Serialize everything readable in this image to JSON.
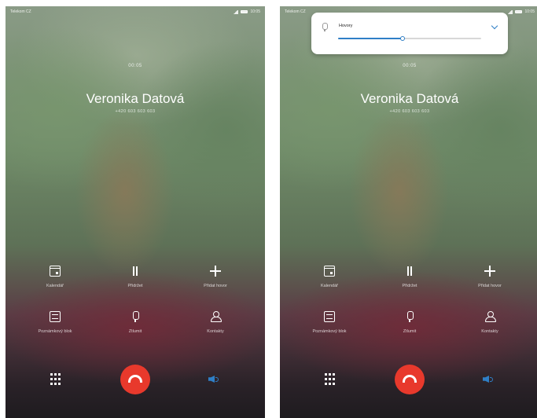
{
  "status_bar": {
    "carrier": "Telekom CZ",
    "time": "10:05"
  },
  "call": {
    "duration": "00:05",
    "caller_name": "Veronika Datová",
    "caller_number": "+420 603 603 603"
  },
  "actions": [
    {
      "label": "Kalendář",
      "icon": "calendar-icon"
    },
    {
      "label": "Přidržet",
      "icon": "pause-icon"
    },
    {
      "label": "Přidat hovor",
      "icon": "plus-icon"
    },
    {
      "label": "Poznámkový blok",
      "icon": "notepad-icon"
    },
    {
      "label": "Ztlumit",
      "icon": "mic-icon"
    },
    {
      "label": "Kontakty",
      "icon": "contacts-icon"
    }
  ],
  "bottom_bar": {
    "dialpad_icon": "dialpad-icon",
    "end_call_icon": "end-call-icon",
    "speaker_icon": "speaker-icon"
  },
  "volume_popup": {
    "label": "Hovory",
    "level": 0.45,
    "icon": "mic-icon",
    "expand_icon": "chevron-down-icon"
  },
  "colors": {
    "end_call": "#e8392c",
    "accent": "#2f7fc6"
  }
}
